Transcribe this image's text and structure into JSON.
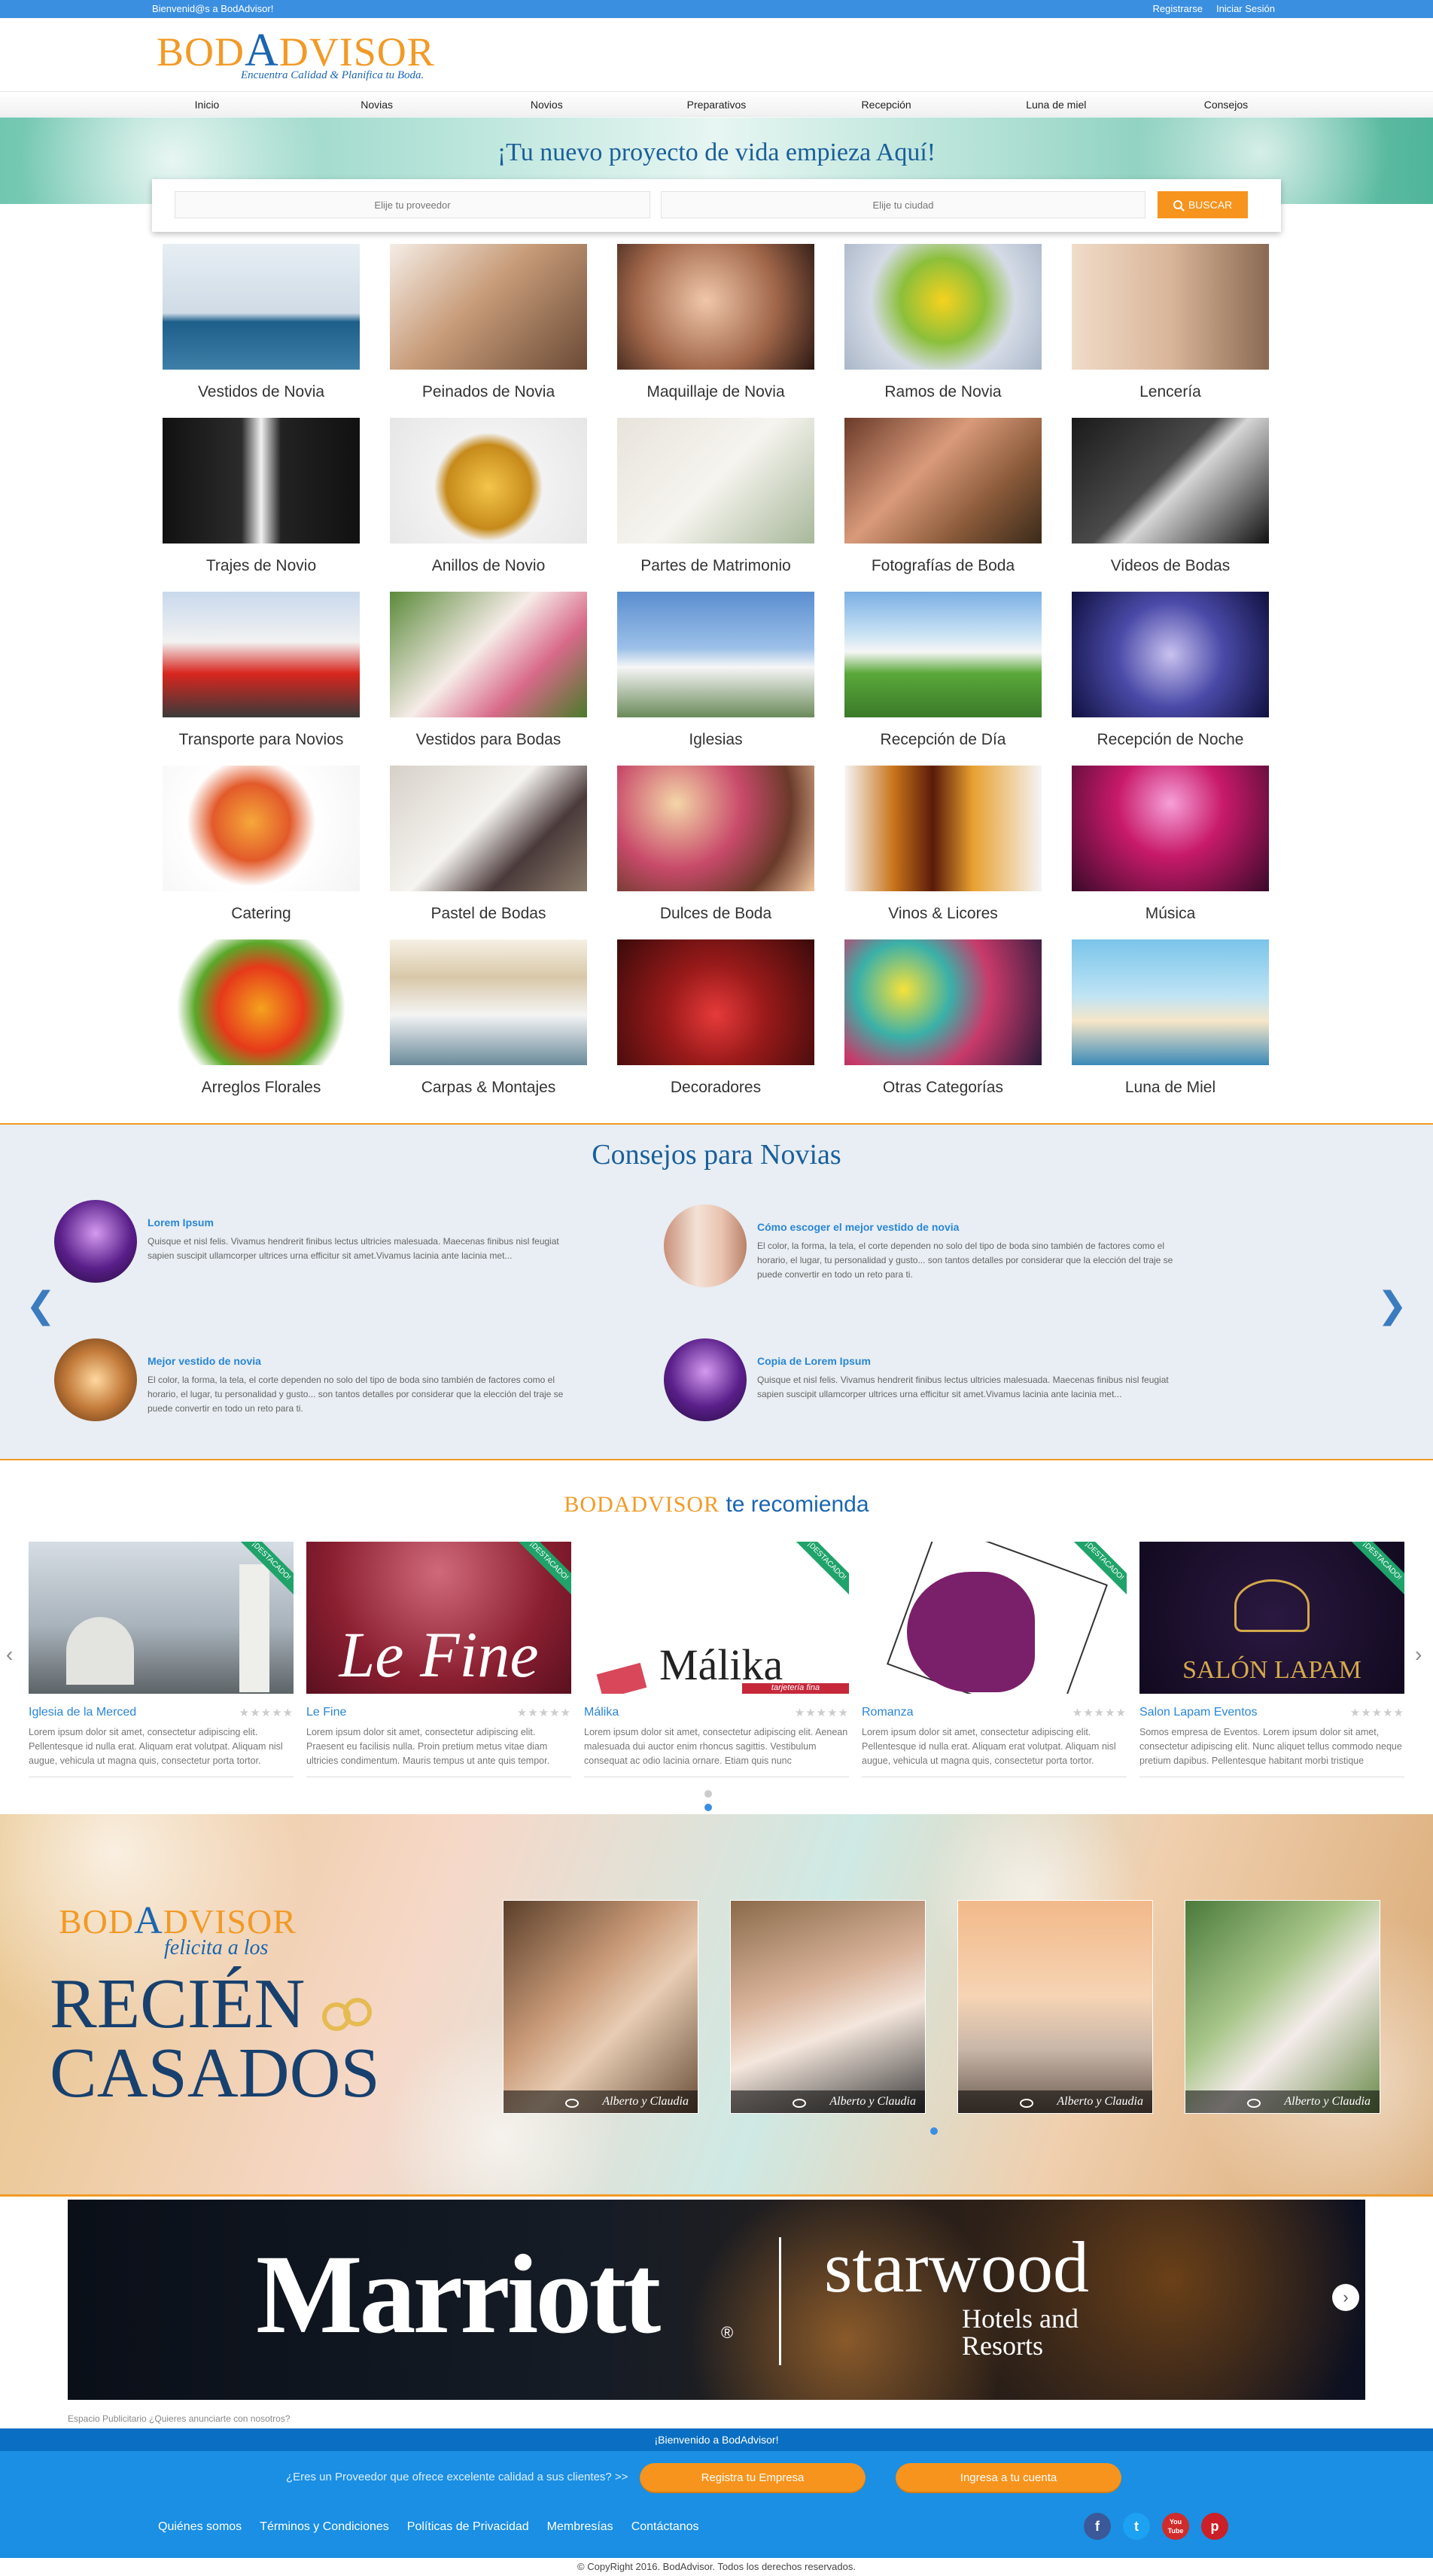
{
  "topbar": {
    "welcome": "Bienvenid@s a BodAdvisor!",
    "register": "Registrarse",
    "login": "Iniciar Sesión"
  },
  "logo": {
    "brand_left": "BOD",
    "brand_a": "A",
    "brand_right": "DVISOR",
    "tagline": "Encuentra Calidad & Planifica tu Boda."
  },
  "nav": [
    "Inicio",
    "Novias",
    "Novios",
    "Preparativos",
    "Recepción",
    "Luna de miel",
    "Consejos"
  ],
  "hero": {
    "title": "¡Tu nuevo proyecto de vida empieza Aquí!"
  },
  "search": {
    "provider_placeholder": "Elije tu proveedor",
    "city_placeholder": "Elije tu ciudad",
    "button": "BUSCAR"
  },
  "categories": [
    "Vestidos de Novia",
    "Peinados de Novia",
    "Maquillaje de Novia",
    "Ramos de Novia",
    "Lencería",
    "Trajes de Novio",
    "Anillos de Novio",
    "Partes de Matrimonio",
    "Fotografías de Boda",
    "Videos de Bodas",
    "Transporte para Novios",
    "Vestidos para Bodas",
    "Iglesias",
    "Recepción de Día",
    "Recepción de Noche",
    "Catering",
    "Pastel de Bodas",
    "Dulces de Boda",
    "Vinos & Licores",
    "Música",
    "Arreglos Florales",
    "Carpas & Montajes",
    "Decoradores",
    "Otras Categorías",
    "Luna de Miel"
  ],
  "consejos": {
    "title": "Consejos para Novias",
    "posts": [
      {
        "title": "Lorem Ipsum",
        "text": "Quisque et nisl felis. Vivamus hendrerit finibus lectus ultricies malesuada. Maecenas finibus nisl feugiat sapien suscipit ullamcorper ultrices urna efficitur sit amet.Vivamus lacinia ante lacinia met..."
      },
      {
        "title": "Cómo escoger el mejor vestido de novia",
        "text": "El color, la forma, la tela, el corte dependen no solo del tipo de boda sino también de factores como el horario, el lugar, tu personalidad y gusto... son tantos detalles por considerar que la elección del traje se puede convertir en todo un reto para ti."
      },
      {
        "title": "Mejor vestido de novia",
        "text": "El color, la forma, la tela, el corte dependen no solo del tipo de boda sino también de factores como el horario, el lugar, tu personalidad y gusto... son tantos detalles por considerar que la elección del traje se puede convertir en todo un reto para ti."
      },
      {
        "title": "Copia de Lorem Ipsum",
        "text": "Quisque et nisl felis. Vivamus hendrerit finibus lectus ultricies malesuada. Maecenas finibus nisl feugiat sapien suscipit ullamcorper ultrices urna efficitur sit amet.Vivamus lacinia ante lacinia met..."
      }
    ]
  },
  "recomienda": {
    "brand": "BODADVISOR",
    "text": " te recomienda"
  },
  "vendors": [
    {
      "name": "Iglesia de la Merced",
      "badge": "¡DESTACADO!",
      "text": "Lorem ipsum dolor sit amet, consectetur adipiscing elit. Pellentesque id nulla erat. Aliquam erat volutpat. Aliquam nisl augue, vehicula ut magna quis, consectetur porta tortor."
    },
    {
      "name": "Le Fine",
      "badge": "¡DESTACADO!",
      "text": "Lorem ipsum dolor sit amet, consectetur adipiscing elit. Praesent eu facilisis nulla. Proin pretium metus vitae diam ultricies condimentum. Mauris tempus ut ante quis tempor."
    },
    {
      "name": "Málika",
      "badge": "¡DESTACADO!",
      "text": "Lorem ipsum dolor sit amet, consectetur adipiscing elit. Aenean malesuada dui auctor enim rhoncus sagittis. Vestibulum consequat ac odio lacinia ornare. Etiam quis nunc"
    },
    {
      "name": "Romanza",
      "badge": "¡DESTACADO!",
      "text": "Lorem ipsum dolor sit amet, consectetur adipiscing elit. Pellentesque id nulla erat. Aliquam erat volutpat. Aliquam nisl augue, vehicula ut magna quis, consectetur porta tortor."
    },
    {
      "name": "Salon Lapam Eventos",
      "badge": "¡DESTACADO!",
      "text": "Somos empresa de Eventos. Lorem ipsum dolor sit amet, consectetur adipiscing elit. Nunc aliquet tellus commodo neque pretium dapibus. Pellentesque habitant morbi tristique"
    }
  ],
  "vendor_images": {
    "malika": "Málika",
    "malika_sub": "tarjetería fina",
    "lefine": "Le Fine",
    "lapam": "SALÓN LAPAM"
  },
  "casados": {
    "brand_left": "BOD",
    "brand_a": "A",
    "brand_right": "DVISOR",
    "felicita": "felicita a los",
    "line1": "RECIÉN",
    "line2": "CASADOS",
    "couples": [
      "Alberto y Claudia",
      "Alberto y Claudia",
      "Alberto y Claudia",
      "Alberto y Claudia"
    ]
  },
  "ad": {
    "brand1": "Marriott",
    "brand2": "starwood",
    "brand2_sub1": "Hotels and",
    "brand2_sub2": "Resorts",
    "note": "Espacio Publicitario ¿Quieres anunciarte con nosotros?"
  },
  "footer": {
    "welcome": "¡Bienvenido a BodAdvisor!",
    "question": "¿Eres un Proveedor que ofrece excelente calidad a sus clientes? >>",
    "register_btn": "Registra tu Empresa",
    "login_btn": "Ingresa a tu cuenta",
    "links": [
      "Quiénes somos",
      "Términos y Condiciones",
      "Políticas de Privacidad",
      "Membresías",
      "Contáctanos"
    ],
    "social": [
      "f",
      "t",
      "You Tube",
      "p"
    ],
    "copyright": "© CopyRight 2016. BodAdvisor. Todos los derechos reservados."
  },
  "colors": {
    "accent": "#f7941d",
    "primary": "#3b8fe0",
    "brand_blue": "#1a66b0"
  }
}
